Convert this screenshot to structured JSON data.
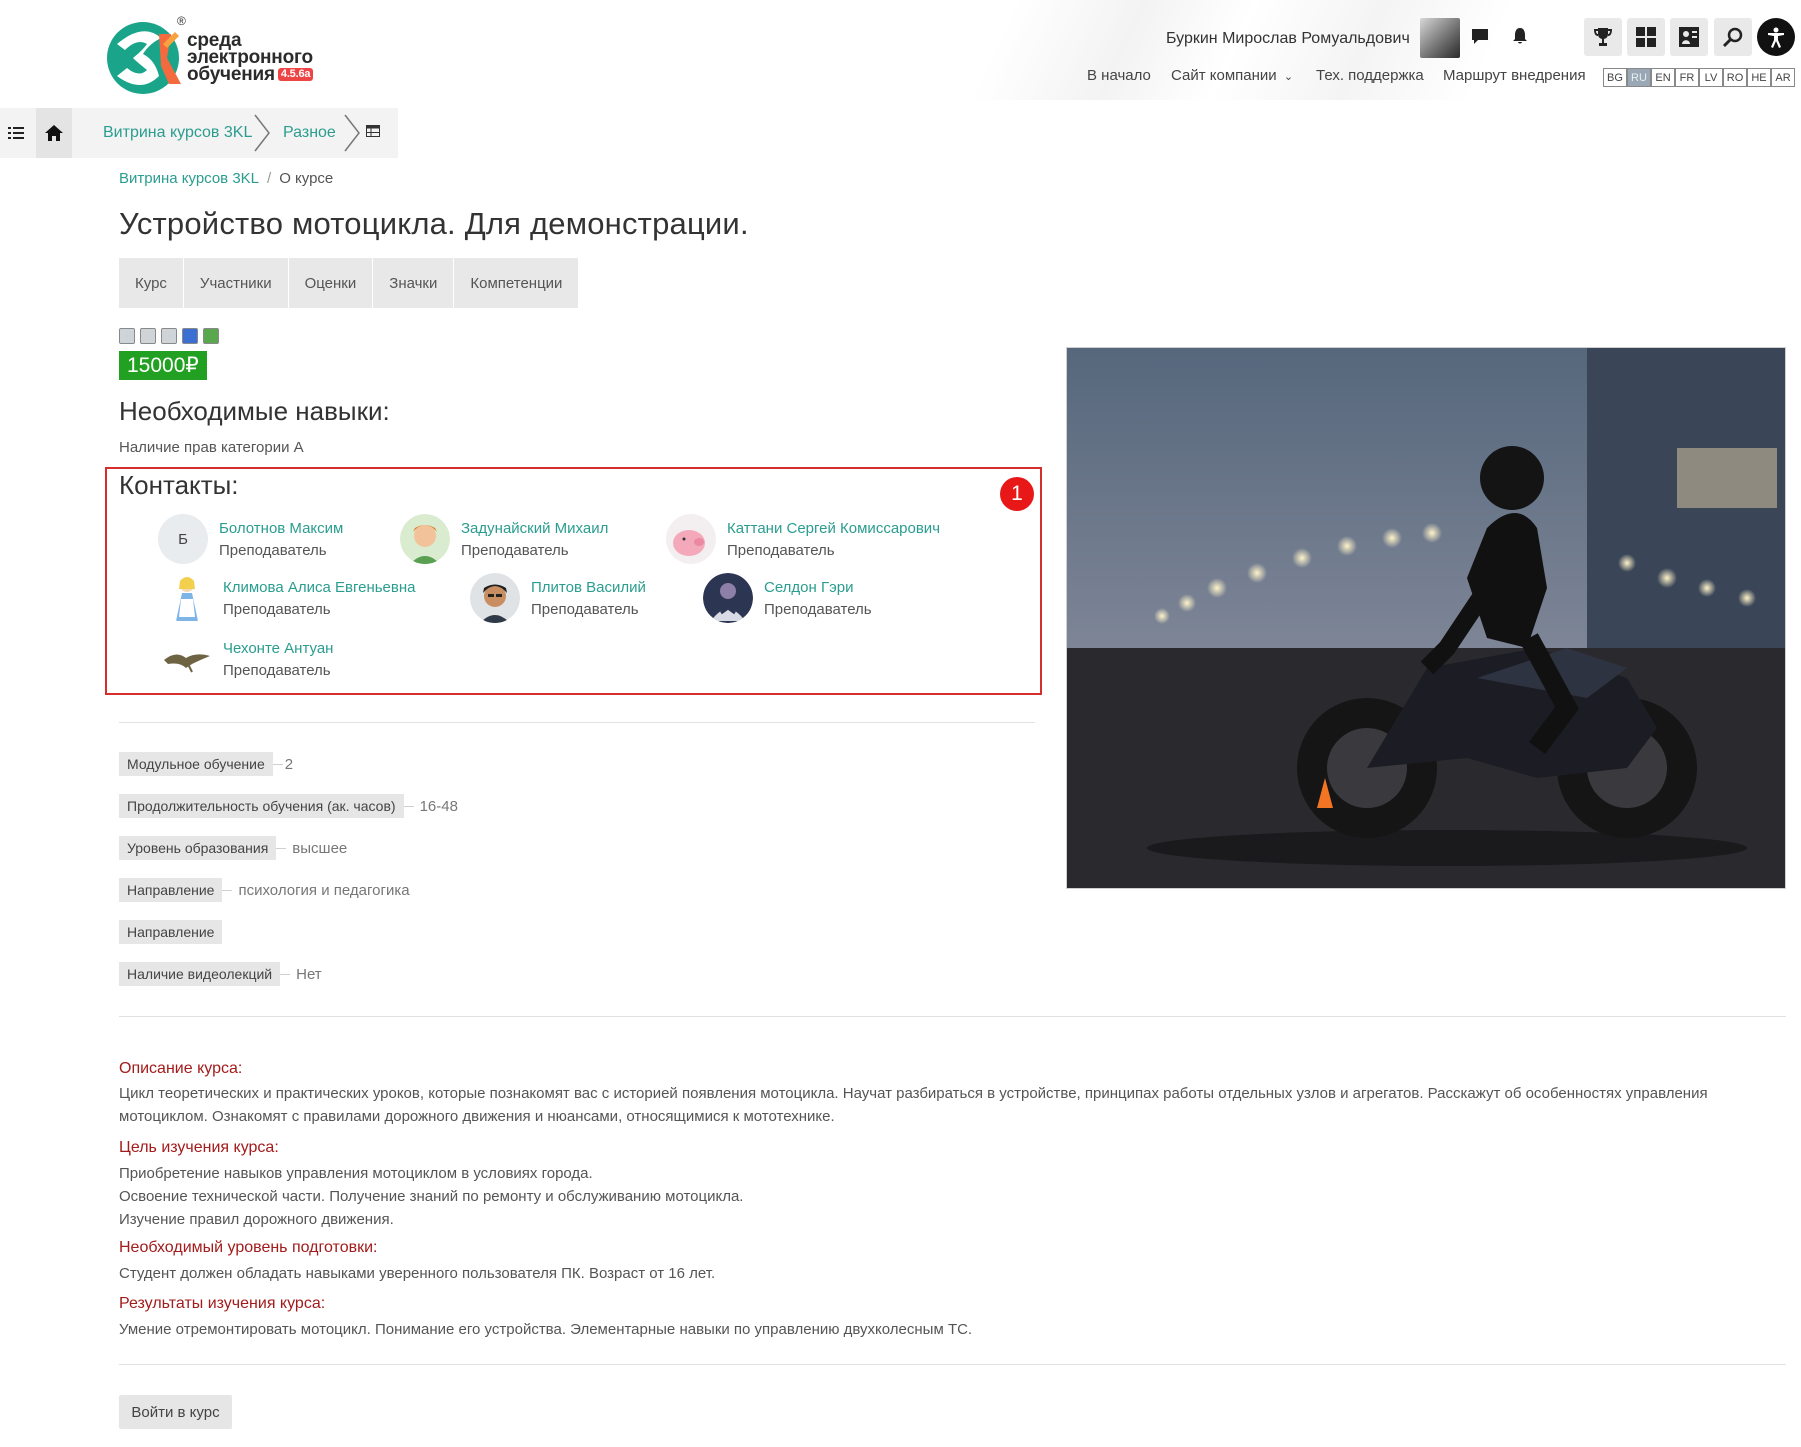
{
  "header": {
    "logo_text_line1": "среда",
    "logo_text_line2": "электронного",
    "logo_text_line3": "обучения",
    "logo_version": "4.5.6a",
    "logo_reg": "®",
    "user_name": "Буркин Мирослав Ромуальдович",
    "nav": [
      "В начало",
      "Сайт компании",
      "Тех. поддержка",
      "Маршрут внедрения"
    ],
    "languages": [
      "BG",
      "RU",
      "EN",
      "FR",
      "LV",
      "RO",
      "HE",
      "AR"
    ],
    "active_language": "RU",
    "icons": [
      "chat-icon",
      "bell-icon",
      "trophy-icon",
      "dashboard-icon",
      "portfolio-icon",
      "search-icon",
      "accessibility-icon"
    ]
  },
  "breadcrumb_bar": {
    "items": [
      "Витрина курсов 3KL",
      "Разное"
    ]
  },
  "breadcrumb": {
    "link": "Витрина курсов 3KL",
    "current": "О курсе"
  },
  "course": {
    "title": "Устройство мотоцикла. Для демонстрации.",
    "tabs": [
      "Курс",
      "Участники",
      "Оценки",
      "Значки",
      "Компетенции"
    ],
    "price": "15000₽",
    "skills_title": "Необходимые навыки:",
    "skills_text": "Наличие прав категории А",
    "contacts_title": "Контакты:",
    "marker": "1",
    "contacts": [
      {
        "name": "Болотнов Максим",
        "role": "Преподаватель",
        "initial": "Б"
      },
      {
        "name": "Задунайский Михаил",
        "role": "Преподаватель"
      },
      {
        "name": "Каттани Сергей Комиссарович",
        "role": "Преподаватель"
      },
      {
        "name": "Климова Алиса Евгеньевна",
        "role": "Преподаватель"
      },
      {
        "name": "Плитов Василий",
        "role": "Преподаватель"
      },
      {
        "name": "Селдон Гэри",
        "role": "Преподаватель"
      },
      {
        "name": "Чехонте Антуан",
        "role": "Преподаватель"
      }
    ],
    "properties": [
      {
        "key": "Модульное обучение",
        "value": "2"
      },
      {
        "key": "Продолжительность обучения (ак. часов)",
        "value": "16-48"
      },
      {
        "key": "Уровень образования",
        "value": "высшее"
      },
      {
        "key": "Направление",
        "value": "психология и педагогика"
      },
      {
        "key": "Направление",
        "value": ""
      },
      {
        "key": "Наличие видеолекций",
        "value": "Нет"
      }
    ],
    "description": {
      "desc_title": "Описание курса:",
      "desc_text": "Цикл теоретических и практических уроков, которые познакомят вас с историей появления мотоцикла. Научат разбираться в устройстве, принципах работы отдельных узлов и агрегатов. Расскажут об особенностях управления мотоциклом.  Ознакомят с правилами дорожного движения и нюансами, относящимися к мототехнике.",
      "goal_title": "Цель изучения курса:",
      "goal_line1": "Приобретение навыков управления мотоциклом в условиях города.",
      "goal_line2": "Освоение технической части. Получение знаний по ремонту и обслуживанию мотоцикла.",
      "goal_line3": "Изучение правил дорожного движения.",
      "level_title": "Необходимый уровень подготовки:",
      "level_text": "Студент должен обладать навыками уверенного пользователя ПК. Возраст от 16 лет.",
      "results_title": "Результаты изучения курса:",
      "results_text": "Умение отремонтировать мотоцикл. Понимание его устройства. Элементарные навыки по управлению двухколесным ТС."
    },
    "enter_button": "Войти в курс"
  },
  "colors": {
    "accent": "#2a9d8f",
    "price_bg": "#22a022",
    "highlight_border": "#d62d2d",
    "section_heading": "#a31b1b"
  }
}
